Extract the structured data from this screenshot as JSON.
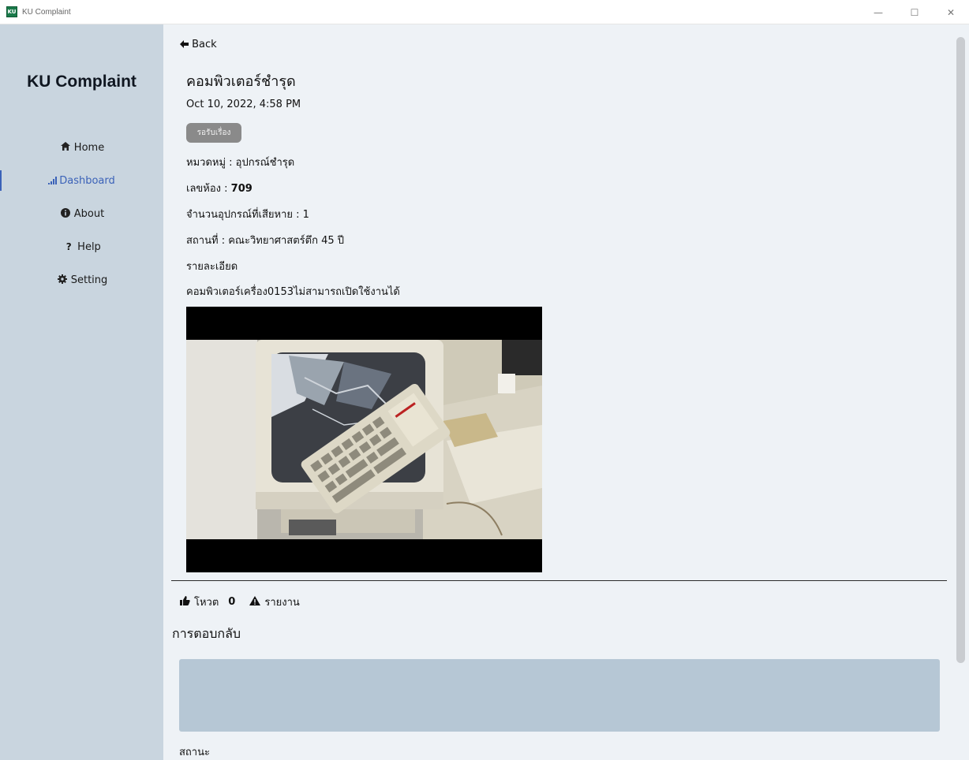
{
  "window": {
    "title": "KU Complaint",
    "icon_text": "KU",
    "controls": {
      "minimize": "—",
      "maximize": "☐",
      "close": "✕"
    }
  },
  "sidebar": {
    "brand": "KU Complaint",
    "items": [
      {
        "label": "Home",
        "icon": "home-icon",
        "active": false
      },
      {
        "label": "Dashboard",
        "icon": "signal-bars-icon",
        "active": true
      },
      {
        "label": "About",
        "icon": "info-icon",
        "active": false
      },
      {
        "label": "Help",
        "icon": "question-icon",
        "active": false
      },
      {
        "label": "Setting",
        "icon": "gear-icon",
        "active": false
      }
    ],
    "active_color": "#3b62b8"
  },
  "complaint": {
    "back_label": "Back",
    "title": "คอมพิวเตอร์ชำรุด",
    "date": "Oct 10, 2022, 4:58 PM",
    "status_badge": "รอรับเรื่อง",
    "category_label": "หมวดหมู่ : ",
    "category_value": "อุปกรณ์ชำรุด",
    "room_label": "เลขห้อง : ",
    "room_value": "709",
    "damaged_label": "จำนวนอุปกรณ์ที่เสียหาย : ",
    "damaged_value": "1",
    "location_label": "สถานที่ : ",
    "location_value": "คณะวิทยาศาสตร์ตึก 45 ปี",
    "details_label": "รายละเอียด",
    "details_value": "คอมพิวเตอร์เครื่อง0153ไม่สามารถเปิดใช้งานได้",
    "photo_desc": "broken-crt-monitor-photo"
  },
  "actions": {
    "vote_label": "โหวต",
    "vote_count": "0",
    "report_label": "รายงาน"
  },
  "reply": {
    "heading": "การตอบกลับ",
    "status_label": "สถานะ"
  },
  "colors": {
    "sidebar_bg": "#c9d5df",
    "main_bg": "#eef2f6",
    "badge_bg": "#8a8a8a",
    "reply_box_bg": "#b6c7d5"
  }
}
